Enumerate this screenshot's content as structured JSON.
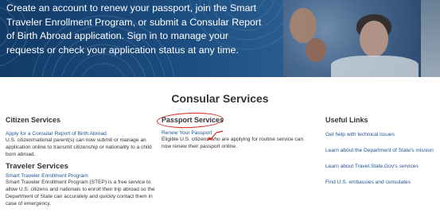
{
  "hero": {
    "lines": [
      "Create an account to renew your passport, join the Smart",
      "Traveler Enrollment Program, or submit a Consular Report",
      "of Birth Abroad application. Sign in to manage your",
      "requests or check your application status at any time."
    ]
  },
  "section": {
    "title": "Consular Services"
  },
  "citizen": {
    "title": "Citizen Services",
    "link": "Apply for a Consular Report of Birth Abroad",
    "desc": "U.S. citizen/national parent(s) can now submit or manage an application online to transmit citizenship or nationality to a child born abroad."
  },
  "traveler": {
    "title": "Traveler Services",
    "link": "Smart Traveler Enrollment Program",
    "desc": "Smart Traveler Enrollment Program (STEP) is a free service to allow U.S. citizens and nationals to enroll their trip abroad so the Department of State can accurately and quickly contact them in case of emergency."
  },
  "passport": {
    "title": "Passport Services",
    "link": "Renew Your Passport",
    "desc": "Eligible U.S. citizens who are applying for routine service can now renew their passport online."
  },
  "useful": {
    "title": "Useful Links",
    "links": [
      "Get help with technical issues",
      "Learn about the Department of State's mission",
      "Learn about Travel.State.Gov's services",
      "Find U.S. embassies and consulates"
    ]
  },
  "colors": {
    "link": "#205493",
    "annotation": "#d7261e",
    "hero_bg": "#1d4f82"
  }
}
